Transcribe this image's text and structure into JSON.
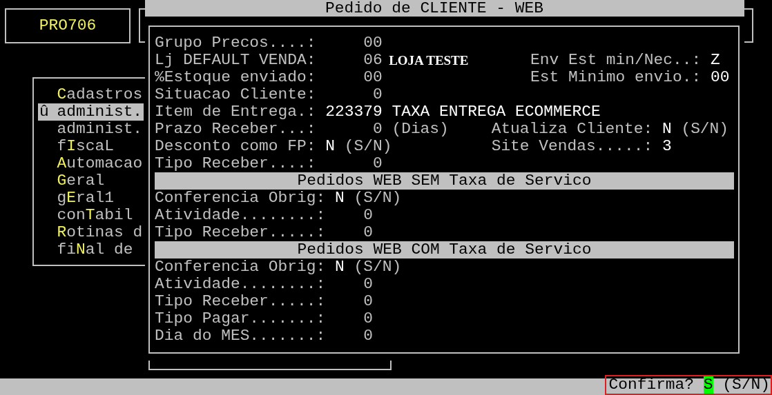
{
  "header_box": {
    "code": "PRO706"
  },
  "menu": {
    "items": [
      {
        "key": "C",
        "after": "adastros",
        "selected": false
      },
      {
        "marker": "û",
        "text": "administ.",
        "selected": true
      },
      {
        "text": "administ.",
        "selected": false
      },
      {
        "before": "f",
        "key": "I",
        "after": "scaL",
        "selected": false
      },
      {
        "key": "A",
        "after": "utomacao",
        "selected": false
      },
      {
        "key": "G",
        "after": "eral",
        "selected": false
      },
      {
        "before": "g",
        "key": "E",
        "after": "ral1",
        "selected": false
      },
      {
        "before": "con",
        "key": "T",
        "after": "abil",
        "selected": false
      },
      {
        "key": "R",
        "after": "otinas d",
        "selected": false
      },
      {
        "before": "fi",
        "key": "N",
        "after": "al de",
        "selected": false
      }
    ]
  },
  "dialog": {
    "title": "Pedido de CLIENTE - WEB",
    "fields": [
      {
        "label": "Grupo Precos....:",
        "value": "00",
        "kind": "number",
        "bright": false
      },
      {
        "label": "Lj DEFAULT VENDA:",
        "value": "06",
        "kind": "number",
        "bright": false,
        "note": {
          "text": "LOJA TESTE",
          "kind": "proportional"
        },
        "right": {
          "label": "Env Est min/Nec..:",
          "value": "Z"
        }
      },
      {
        "label": "%Estoque enviado:",
        "value": "00",
        "kind": "number",
        "bright": false,
        "right": {
          "label": "Est Minimo envio.:",
          "value": "00"
        }
      },
      {
        "label": "Situacao Cliente:",
        "value": "0",
        "kind": "number",
        "bright": false
      },
      {
        "label": "Item de Entrega.:",
        "value": "223379",
        "kind": "number",
        "bright": true,
        "note": {
          "text": "TAXA ENTREGA ECOMMERCE",
          "kind": "highlight"
        }
      },
      {
        "label": "Prazo Receber...:",
        "value": "0",
        "kind": "number",
        "bright": false,
        "note": {
          "text": "(Dias)",
          "kind": "plain"
        },
        "right": {
          "label": "Atualiza Cliente:",
          "value": "N",
          "note": "(S/N)"
        }
      },
      {
        "label": "Desconto como FP:",
        "value": "N",
        "kind": "flag",
        "bright": true,
        "note": {
          "text": "(S/N)",
          "kind": "plain"
        },
        "right": {
          "label": "Site Vendas.....:",
          "value": "3"
        }
      },
      {
        "label": "Tipo Receber....:",
        "value": "0",
        "kind": "number",
        "bright": false
      }
    ],
    "sections": [
      {
        "title": "Pedidos WEB SEM Taxa de Servico",
        "fields": [
          {
            "label": "Conferencia Obrig:",
            "value": "N",
            "kind": "flag",
            "bright": true,
            "note": {
              "text": "(S/N)",
              "kind": "plain"
            }
          },
          {
            "label": "Atividade........:",
            "value": "0",
            "kind": "number",
            "bright": false
          },
          {
            "label": "Tipo Receber.....:",
            "value": "0",
            "kind": "number",
            "bright": false
          }
        ]
      },
      {
        "title": "Pedidos WEB COM Taxa de Servico",
        "fields": [
          {
            "label": "Conferencia Obrig:",
            "value": "N",
            "kind": "flag",
            "bright": true,
            "note": {
              "text": "(S/N)",
              "kind": "plain"
            }
          },
          {
            "label": "Atividade........:",
            "value": "0",
            "kind": "number",
            "bright": false
          },
          {
            "label": "Tipo Receber.....:",
            "value": "0",
            "kind": "number",
            "bright": false
          },
          {
            "label": "Tipo Pagar.......:",
            "value": "0",
            "kind": "number",
            "bright": false
          },
          {
            "label": "Dia do MES.......:",
            "value": "0",
            "kind": "number",
            "bright": false
          }
        ]
      }
    ]
  },
  "status_bar": {
    "prompt": "Confirma?",
    "answer": "S",
    "options": "(S/N)",
    "highlighted": true
  }
}
